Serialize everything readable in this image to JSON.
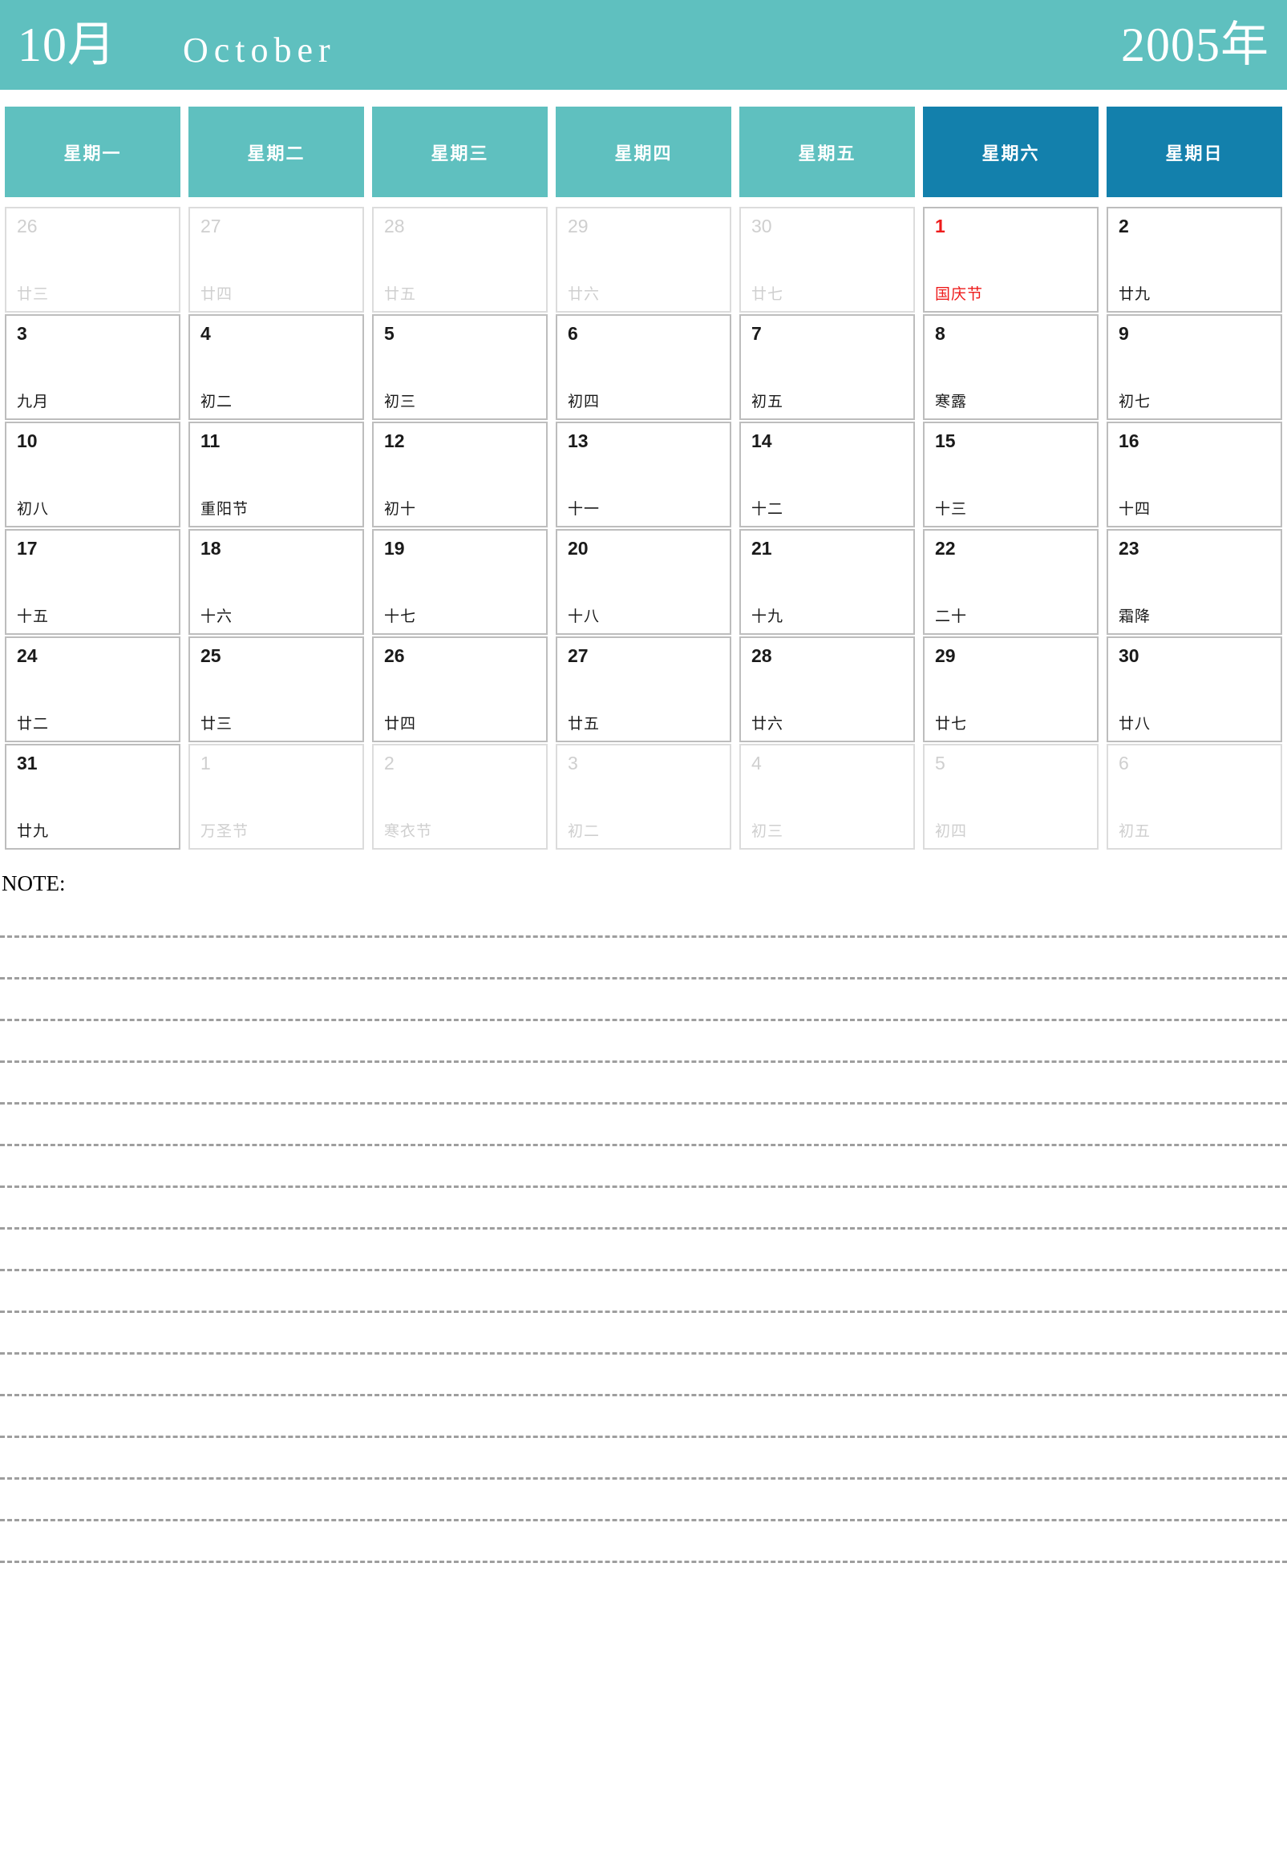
{
  "header": {
    "month_cn": "10月",
    "month_en": "October",
    "year_cn": "2005年",
    "bg_color": "#5FC0BF",
    "text_color": "#FFFFFF"
  },
  "weekdays": [
    {
      "label": "星期一",
      "weekend": false,
      "bg_color": "#5FC0BF"
    },
    {
      "label": "星期二",
      "weekend": false,
      "bg_color": "#5FC0BF"
    },
    {
      "label": "星期三",
      "weekend": false,
      "bg_color": "#5FC0BF"
    },
    {
      "label": "星期四",
      "weekend": false,
      "bg_color": "#5FC0BF"
    },
    {
      "label": "星期五",
      "weekend": false,
      "bg_color": "#5FC0BF"
    },
    {
      "label": "星期六",
      "weekend": true,
      "bg_color": "#1380AC"
    },
    {
      "label": "星期日",
      "weekend": true,
      "bg_color": "#1380AC"
    }
  ],
  "colors": {
    "teal": "#5FC0BF",
    "blue": "#1380AC",
    "holiday_red": "#EE1C1C",
    "out_of_month_gray": "#CFCFCF",
    "cell_border": "#BDBDBD"
  },
  "weeks": [
    [
      {
        "day": "26",
        "lunar": "廿三",
        "out": true,
        "holiday": false
      },
      {
        "day": "27",
        "lunar": "廿四",
        "out": true,
        "holiday": false
      },
      {
        "day": "28",
        "lunar": "廿五",
        "out": true,
        "holiday": false
      },
      {
        "day": "29",
        "lunar": "廿六",
        "out": true,
        "holiday": false
      },
      {
        "day": "30",
        "lunar": "廿七",
        "out": true,
        "holiday": false
      },
      {
        "day": "1",
        "lunar": "国庆节",
        "out": false,
        "holiday": true
      },
      {
        "day": "2",
        "lunar": "廿九",
        "out": false,
        "holiday": false
      }
    ],
    [
      {
        "day": "3",
        "lunar": "九月",
        "out": false,
        "holiday": false
      },
      {
        "day": "4",
        "lunar": "初二",
        "out": false,
        "holiday": false
      },
      {
        "day": "5",
        "lunar": "初三",
        "out": false,
        "holiday": false
      },
      {
        "day": "6",
        "lunar": "初四",
        "out": false,
        "holiday": false
      },
      {
        "day": "7",
        "lunar": "初五",
        "out": false,
        "holiday": false
      },
      {
        "day": "8",
        "lunar": "寒露",
        "out": false,
        "holiday": false
      },
      {
        "day": "9",
        "lunar": "初七",
        "out": false,
        "holiday": false
      }
    ],
    [
      {
        "day": "10",
        "lunar": "初八",
        "out": false,
        "holiday": false
      },
      {
        "day": "11",
        "lunar": "重阳节",
        "out": false,
        "holiday": false
      },
      {
        "day": "12",
        "lunar": "初十",
        "out": false,
        "holiday": false
      },
      {
        "day": "13",
        "lunar": "十一",
        "out": false,
        "holiday": false
      },
      {
        "day": "14",
        "lunar": "十二",
        "out": false,
        "holiday": false
      },
      {
        "day": "15",
        "lunar": "十三",
        "out": false,
        "holiday": false
      },
      {
        "day": "16",
        "lunar": "十四",
        "out": false,
        "holiday": false
      }
    ],
    [
      {
        "day": "17",
        "lunar": "十五",
        "out": false,
        "holiday": false
      },
      {
        "day": "18",
        "lunar": "十六",
        "out": false,
        "holiday": false
      },
      {
        "day": "19",
        "lunar": "十七",
        "out": false,
        "holiday": false
      },
      {
        "day": "20",
        "lunar": "十八",
        "out": false,
        "holiday": false
      },
      {
        "day": "21",
        "lunar": "十九",
        "out": false,
        "holiday": false
      },
      {
        "day": "22",
        "lunar": "二十",
        "out": false,
        "holiday": false
      },
      {
        "day": "23",
        "lunar": "霜降",
        "out": false,
        "holiday": false
      }
    ],
    [
      {
        "day": "24",
        "lunar": "廿二",
        "out": false,
        "holiday": false
      },
      {
        "day": "25",
        "lunar": "廿三",
        "out": false,
        "holiday": false
      },
      {
        "day": "26",
        "lunar": "廿四",
        "out": false,
        "holiday": false
      },
      {
        "day": "27",
        "lunar": "廿五",
        "out": false,
        "holiday": false
      },
      {
        "day": "28",
        "lunar": "廿六",
        "out": false,
        "holiday": false
      },
      {
        "day": "29",
        "lunar": "廿七",
        "out": false,
        "holiday": false
      },
      {
        "day": "30",
        "lunar": "廿八",
        "out": false,
        "holiday": false
      }
    ],
    [
      {
        "day": "31",
        "lunar": "廿九",
        "out": false,
        "holiday": false
      },
      {
        "day": "1",
        "lunar": "万圣节",
        "out": true,
        "holiday": false
      },
      {
        "day": "2",
        "lunar": "寒衣节",
        "out": true,
        "holiday": false
      },
      {
        "day": "3",
        "lunar": "初二",
        "out": true,
        "holiday": false
      },
      {
        "day": "4",
        "lunar": "初三",
        "out": true,
        "holiday": false
      },
      {
        "day": "5",
        "lunar": "初四",
        "out": true,
        "holiday": false
      },
      {
        "day": "6",
        "lunar": "初五",
        "out": true,
        "holiday": false
      }
    ]
  ],
  "note": {
    "label": "NOTE:",
    "line_count": 16
  }
}
